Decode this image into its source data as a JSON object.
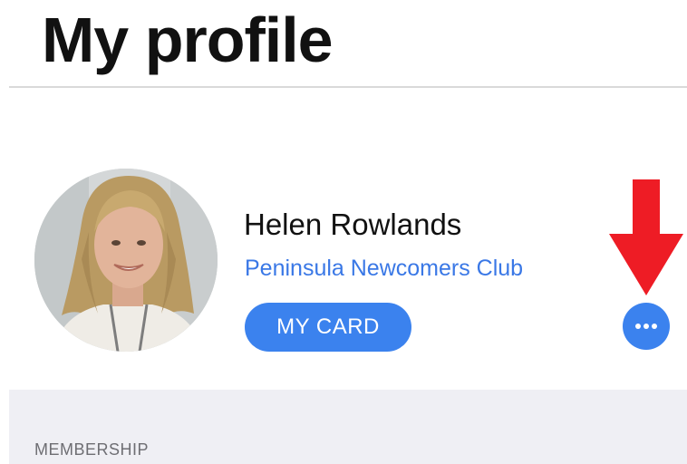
{
  "header": {
    "title": "My profile"
  },
  "profile": {
    "name": "Helen Rowlands",
    "club": "Peninsula Newcomers Club",
    "card_button_label": "MY CARD",
    "more_button_icon": "more-horizontal-icon",
    "avatar": "profile-photo"
  },
  "annotation": {
    "icon": "red-down-arrow",
    "color": "#ee1c25"
  },
  "sections": {
    "membership_label": "MEMBERSHIP"
  },
  "colors": {
    "accent": "#3b82ee",
    "link": "#3a78e6",
    "section_bg": "#efeff4"
  }
}
